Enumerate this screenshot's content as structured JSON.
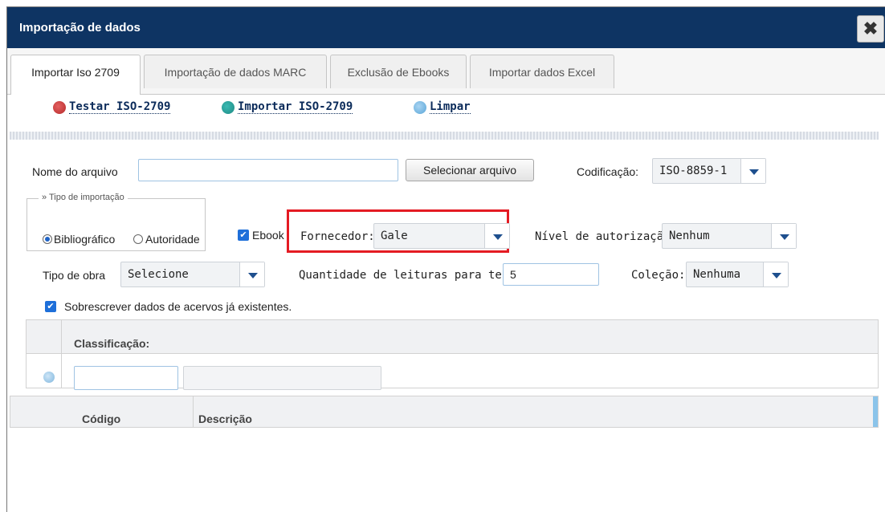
{
  "window": {
    "title": "Importação de dados",
    "close_icon": "close-x-icon"
  },
  "tabs": [
    {
      "label": "Importar Iso 2709",
      "active": true
    },
    {
      "label": "Importação de dados MARC",
      "active": false
    },
    {
      "label": "Exclusão de Ebooks",
      "active": false
    },
    {
      "label": "Importar dados Excel",
      "active": false
    }
  ],
  "toolbar": {
    "test_label": "Testar ISO-2709",
    "import_label": "Importar ISO-2709",
    "clear_label": "Limpar",
    "colors": {
      "test_icon": "#b52a2a",
      "import_icon": "#1e8a84",
      "clear_icon": "#5aa6d8"
    }
  },
  "file": {
    "label": "Nome do arquivo",
    "value": "",
    "select_button": "Selecionar arquivo",
    "encoding_label": "Codificação:",
    "encoding_value": "ISO-8859-1"
  },
  "import_type": {
    "legend": "» Tipo de importação",
    "options": [
      "Bibliográfico",
      "Autoridade"
    ],
    "selected": "Bibliográfico"
  },
  "ebook": {
    "label": "Ebook",
    "checked": true
  },
  "supplier": {
    "label": "Fornecedor:",
    "value": "Gale"
  },
  "auth_level": {
    "label": "Nível de autorização:",
    "value": "Nenhum"
  },
  "work_type": {
    "label": "Tipo de obra",
    "value": "Selecione"
  },
  "test_reads": {
    "label": "Quantidade de leituras para teste:",
    "value": "5"
  },
  "collection": {
    "label": "Coleção:",
    "value": "Nenhuma"
  },
  "overwrite": {
    "label": "Sobrescrever dados de acervos já existentes.",
    "checked": true
  },
  "classification": {
    "header": "Classificação:",
    "code_value": "",
    "description_value": ""
  },
  "table": {
    "columns": [
      "Código",
      "Descrição"
    ]
  },
  "accent_color": "#0e3463",
  "highlight_color": "#e41b23"
}
